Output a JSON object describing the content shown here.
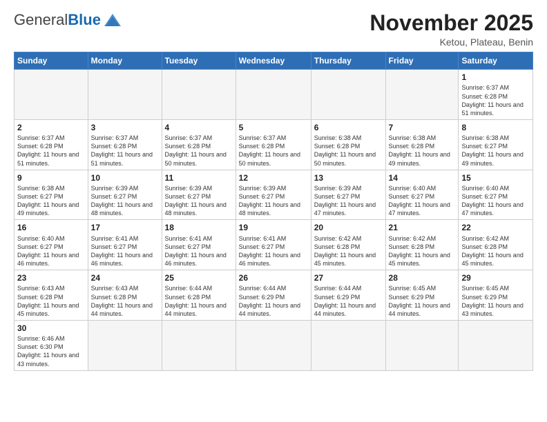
{
  "logo": {
    "general": "General",
    "blue": "Blue"
  },
  "title": "November 2025",
  "location": "Ketou, Plateau, Benin",
  "weekdays": [
    "Sunday",
    "Monday",
    "Tuesday",
    "Wednesday",
    "Thursday",
    "Friday",
    "Saturday"
  ],
  "weeks": [
    [
      {
        "day": "",
        "info": ""
      },
      {
        "day": "",
        "info": ""
      },
      {
        "day": "",
        "info": ""
      },
      {
        "day": "",
        "info": ""
      },
      {
        "day": "",
        "info": ""
      },
      {
        "day": "",
        "info": ""
      },
      {
        "day": "1",
        "info": "Sunrise: 6:37 AM\nSunset: 6:28 PM\nDaylight: 11 hours\nand 51 minutes."
      }
    ],
    [
      {
        "day": "2",
        "info": "Sunrise: 6:37 AM\nSunset: 6:28 PM\nDaylight: 11 hours\nand 51 minutes."
      },
      {
        "day": "3",
        "info": "Sunrise: 6:37 AM\nSunset: 6:28 PM\nDaylight: 11 hours\nand 51 minutes."
      },
      {
        "day": "4",
        "info": "Sunrise: 6:37 AM\nSunset: 6:28 PM\nDaylight: 11 hours\nand 50 minutes."
      },
      {
        "day": "5",
        "info": "Sunrise: 6:37 AM\nSunset: 6:28 PM\nDaylight: 11 hours\nand 50 minutes."
      },
      {
        "day": "6",
        "info": "Sunrise: 6:38 AM\nSunset: 6:28 PM\nDaylight: 11 hours\nand 50 minutes."
      },
      {
        "day": "7",
        "info": "Sunrise: 6:38 AM\nSunset: 6:28 PM\nDaylight: 11 hours\nand 49 minutes."
      },
      {
        "day": "8",
        "info": "Sunrise: 6:38 AM\nSunset: 6:27 PM\nDaylight: 11 hours\nand 49 minutes."
      }
    ],
    [
      {
        "day": "9",
        "info": "Sunrise: 6:38 AM\nSunset: 6:27 PM\nDaylight: 11 hours\nand 49 minutes."
      },
      {
        "day": "10",
        "info": "Sunrise: 6:39 AM\nSunset: 6:27 PM\nDaylight: 11 hours\nand 48 minutes."
      },
      {
        "day": "11",
        "info": "Sunrise: 6:39 AM\nSunset: 6:27 PM\nDaylight: 11 hours\nand 48 minutes."
      },
      {
        "day": "12",
        "info": "Sunrise: 6:39 AM\nSunset: 6:27 PM\nDaylight: 11 hours\nand 48 minutes."
      },
      {
        "day": "13",
        "info": "Sunrise: 6:39 AM\nSunset: 6:27 PM\nDaylight: 11 hours\nand 47 minutes."
      },
      {
        "day": "14",
        "info": "Sunrise: 6:40 AM\nSunset: 6:27 PM\nDaylight: 11 hours\nand 47 minutes."
      },
      {
        "day": "15",
        "info": "Sunrise: 6:40 AM\nSunset: 6:27 PM\nDaylight: 11 hours\nand 47 minutes."
      }
    ],
    [
      {
        "day": "16",
        "info": "Sunrise: 6:40 AM\nSunset: 6:27 PM\nDaylight: 11 hours\nand 46 minutes."
      },
      {
        "day": "17",
        "info": "Sunrise: 6:41 AM\nSunset: 6:27 PM\nDaylight: 11 hours\nand 46 minutes."
      },
      {
        "day": "18",
        "info": "Sunrise: 6:41 AM\nSunset: 6:27 PM\nDaylight: 11 hours\nand 46 minutes."
      },
      {
        "day": "19",
        "info": "Sunrise: 6:41 AM\nSunset: 6:27 PM\nDaylight: 11 hours\nand 46 minutes."
      },
      {
        "day": "20",
        "info": "Sunrise: 6:42 AM\nSunset: 6:28 PM\nDaylight: 11 hours\nand 45 minutes."
      },
      {
        "day": "21",
        "info": "Sunrise: 6:42 AM\nSunset: 6:28 PM\nDaylight: 11 hours\nand 45 minutes."
      },
      {
        "day": "22",
        "info": "Sunrise: 6:42 AM\nSunset: 6:28 PM\nDaylight: 11 hours\nand 45 minutes."
      }
    ],
    [
      {
        "day": "23",
        "info": "Sunrise: 6:43 AM\nSunset: 6:28 PM\nDaylight: 11 hours\nand 45 minutes."
      },
      {
        "day": "24",
        "info": "Sunrise: 6:43 AM\nSunset: 6:28 PM\nDaylight: 11 hours\nand 44 minutes."
      },
      {
        "day": "25",
        "info": "Sunrise: 6:44 AM\nSunset: 6:28 PM\nDaylight: 11 hours\nand 44 minutes."
      },
      {
        "day": "26",
        "info": "Sunrise: 6:44 AM\nSunset: 6:29 PM\nDaylight: 11 hours\nand 44 minutes."
      },
      {
        "day": "27",
        "info": "Sunrise: 6:44 AM\nSunset: 6:29 PM\nDaylight: 11 hours\nand 44 minutes."
      },
      {
        "day": "28",
        "info": "Sunrise: 6:45 AM\nSunset: 6:29 PM\nDaylight: 11 hours\nand 44 minutes."
      },
      {
        "day": "29",
        "info": "Sunrise: 6:45 AM\nSunset: 6:29 PM\nDaylight: 11 hours\nand 43 minutes."
      }
    ],
    [
      {
        "day": "30",
        "info": "Sunrise: 6:46 AM\nSunset: 6:30 PM\nDaylight: 11 hours\nand 43 minutes."
      },
      {
        "day": "",
        "info": ""
      },
      {
        "day": "",
        "info": ""
      },
      {
        "day": "",
        "info": ""
      },
      {
        "day": "",
        "info": ""
      },
      {
        "day": "",
        "info": ""
      },
      {
        "day": "",
        "info": ""
      }
    ]
  ]
}
